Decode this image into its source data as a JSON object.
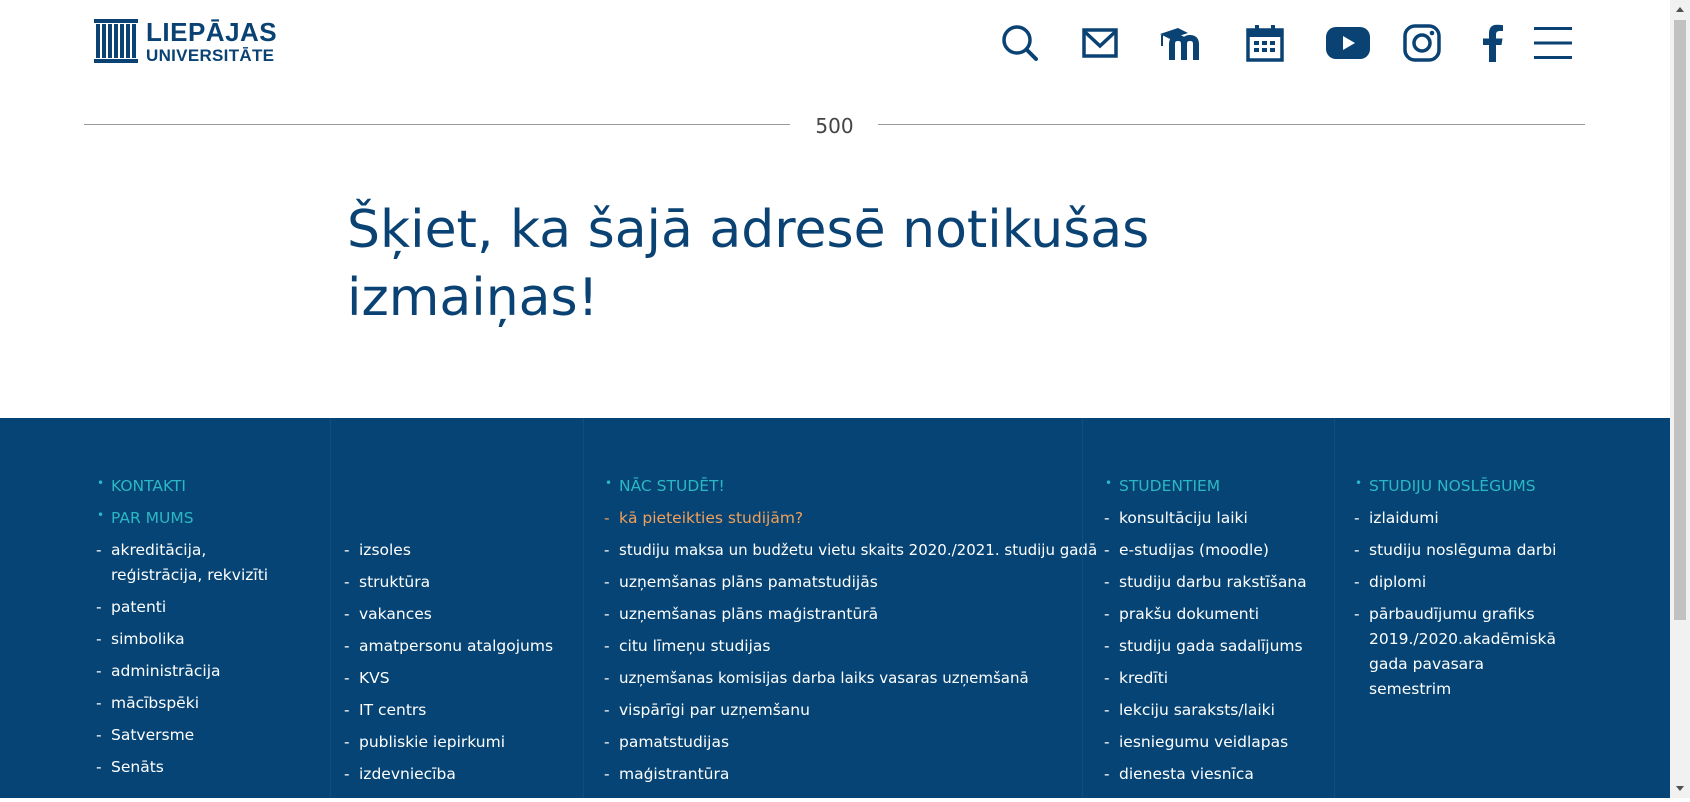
{
  "header": {
    "logo": {
      "line1": "LIEPĀJAS",
      "line2": "UNIVERSITĀTE"
    },
    "icons": [
      "search-icon",
      "mail-icon",
      "moodle-icon",
      "calendar-icon",
      "youtube-icon",
      "instagram-icon",
      "facebook-icon",
      "menu-icon"
    ]
  },
  "error": {
    "code": "500",
    "message": "Šķiet, ka šajā adresē notikušas izmaiņas!"
  },
  "footer": {
    "col1": {
      "sections": [
        "KONTAKTI",
        "PAR MUMS"
      ],
      "items": [
        "akreditācija, reģistrācija, rekvizīti",
        "patenti",
        "simbolika",
        "administrācija",
        "mācībspēki",
        "Satversme",
        "Senāts"
      ]
    },
    "col2": {
      "items": [
        "izsoles",
        "struktūra",
        "vakances",
        "amatpersonu atalgojums",
        "KVS",
        "IT centrs",
        "publiskie iepirkumi",
        "izdevniecība"
      ]
    },
    "col3": {
      "section": "NĀC STUDĒT!",
      "highlight": "kā pieteikties studijām?",
      "items": [
        "studiju maksa un budžetu vietu skaits 2020./2021. studiju gadā",
        "uzņemšanas plāns pamatstudijās",
        "uzņemšanas plāns maģistrantūrā",
        "citu līmeņu studijas",
        "uzņemšanas komisijas darba laiks vasaras uzņemšanā",
        "vispārīgi par uzņemšanu",
        "pamatstudijas",
        "maģistrantūra"
      ]
    },
    "col4": {
      "section": "STUDENTIEM",
      "items": [
        "konsultāciju laiki",
        "e-studijas (moodle)",
        "studiju darbu rakstīšana",
        "prakšu dokumenti",
        "studiju gada sadalījums",
        "kredīti",
        "lekciju saraksts/laiki",
        "iesniegumu veidlapas",
        "dienesta viesnīca"
      ]
    },
    "col5": {
      "section": "STUDIJU NOSLĒGUMS",
      "items": [
        "izlaidumi",
        "studiju noslēguma darbi",
        "diplomi",
        "pārbaudījumu grafiks 2019./2020.akadēmiskā gada pavasara semestrim"
      ]
    }
  },
  "colors": {
    "brand": "#0a4273",
    "footer_bg": "#054474",
    "section_heading": "#2cb7c6",
    "highlight": "#f0a05a"
  }
}
